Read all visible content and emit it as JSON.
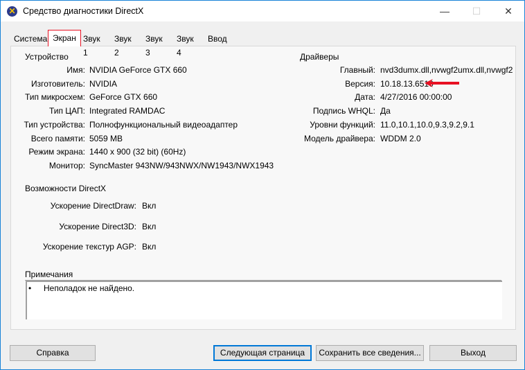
{
  "window": {
    "title": "Средство диагностики DirectX",
    "minimize": "—",
    "maximize": "☐",
    "close": "✕"
  },
  "tabs": [
    "Система",
    "Экран",
    "Звук 1",
    "Звук 2",
    "Звук 3",
    "Звук 4",
    "Ввод"
  ],
  "device": {
    "heading": "Устройство",
    "rows": [
      {
        "label": "Имя:",
        "value": "NVIDIA GeForce GTX 660"
      },
      {
        "label": "Изготовитель:",
        "value": "NVIDIA"
      },
      {
        "label": "Тип микросхем:",
        "value": "GeForce GTX 660"
      },
      {
        "label": "Тип ЦАП:",
        "value": "Integrated RAMDAC"
      },
      {
        "label": "Тип устройства:",
        "value": "Полнофункциональный видеоадаптер"
      },
      {
        "label": "Всего памяти:",
        "value": "5059 MB"
      },
      {
        "label": "Режим экрана:",
        "value": "1440 x 900 (32 bit) (60Hz)"
      },
      {
        "label": "Монитор:",
        "value": "SyncMaster 943NW/943NWX/NW1943/NWX1943"
      }
    ]
  },
  "drivers": {
    "heading": "Драйверы",
    "rows": [
      {
        "label": "Главный:",
        "value": "nvd3dumx.dll,nvwgf2umx.dll,nvwgf2"
      },
      {
        "label": "Версия:",
        "value": "10.18.13.6510"
      },
      {
        "label": "Дата:",
        "value": "4/27/2016 00:00:00"
      },
      {
        "label": "Подпись WHQL:",
        "value": "Да"
      },
      {
        "label": "Уровни функций:",
        "value": "11.0,10.1,10.0,9.3,9.2,9.1"
      },
      {
        "label": "Модель драйвера:",
        "value": "WDDM 2.0"
      }
    ]
  },
  "directx": {
    "heading": "Возможности DirectX",
    "rows": [
      {
        "label": "Ускорение DirectDraw:",
        "value": "Вкл"
      },
      {
        "label": "Ускорение Direct3D:",
        "value": "Вкл"
      },
      {
        "label": "Ускорение текстур AGP:",
        "value": "Вкл"
      }
    ]
  },
  "notes": {
    "heading": "Примечания",
    "items": [
      "Неполадок не найдено."
    ]
  },
  "buttons": {
    "help": "Справка",
    "next": "Следующая страница",
    "save": "Сохранить все сведения...",
    "exit": "Выход"
  },
  "colors": {
    "arrow": "#e81123",
    "accent": "#0078d7"
  }
}
